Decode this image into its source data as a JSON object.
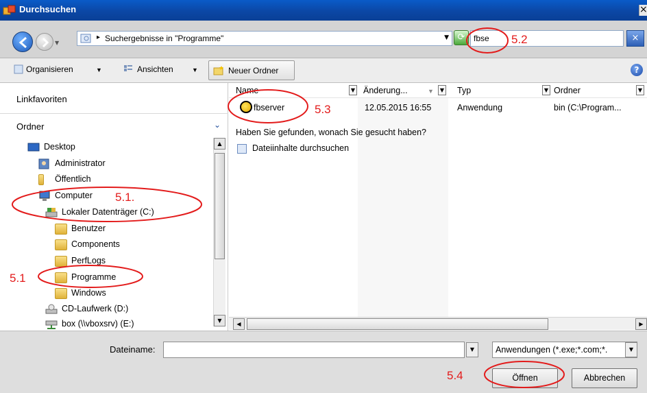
{
  "window": {
    "title": "Durchsuchen",
    "close_glyph": "×"
  },
  "addressbar": {
    "breadcrumb_arrow": "▸",
    "breadcrumb": "Suchergebnisse in \"Programme\"",
    "search_value": "fbse",
    "search_go_glyph": "×",
    "refresh_glyph": "⟳"
  },
  "toolbar": {
    "organize": "Organisieren",
    "views": "Ansichten",
    "new_folder": "Neuer Ordner",
    "help_glyph": "?"
  },
  "leftpane": {
    "favorites_header": "Linkfavoriten",
    "folders_header": "Ordner",
    "tree": [
      {
        "label": "Desktop",
        "icon": "desktop-icon"
      },
      {
        "label": "Administrator",
        "icon": "user-icon"
      },
      {
        "label": "Öffentlich",
        "icon": "folder-icon"
      },
      {
        "label": "Computer",
        "icon": "computer-icon"
      },
      {
        "label": "Lokaler Datenträger (C:)",
        "icon": "drive-icon"
      },
      {
        "label": "Benutzer",
        "icon": "folder-icon"
      },
      {
        "label": "Components",
        "icon": "folder-icon"
      },
      {
        "label": "PerfLogs",
        "icon": "folder-icon"
      },
      {
        "label": "Programme",
        "icon": "folder-icon"
      },
      {
        "label": "Windows",
        "icon": "folder-icon"
      },
      {
        "label": "CD-Laufwerk (D:)",
        "icon": "cd-drive-icon"
      },
      {
        "label": "box (\\\\vboxsrv) (E:)",
        "icon": "network-drive-icon"
      }
    ]
  },
  "results": {
    "columns": [
      "Name",
      "Änderung...",
      "Typ",
      "Ordner"
    ],
    "rows": [
      {
        "name": "fbserver",
        "date": "12.05.2015 16:55",
        "type": "Anwendung",
        "folder": "bin (C:\\Program..."
      }
    ],
    "found_question": "Haben Sie gefunden, wonach Sie gesucht haben?",
    "search_contents": "Dateiinhalte durchsuchen"
  },
  "bottom": {
    "filename_label": "Dateiname:",
    "filename_value": "",
    "filter_value": "Anwendungen (*.exe;*.com;*.",
    "open_button": "Öffnen",
    "cancel_button": "Abbrechen"
  },
  "annotations": {
    "labels": [
      "5.2",
      "5.3",
      "5.1.",
      "5.1",
      "5.4"
    ],
    "color": "#e31b1b"
  }
}
